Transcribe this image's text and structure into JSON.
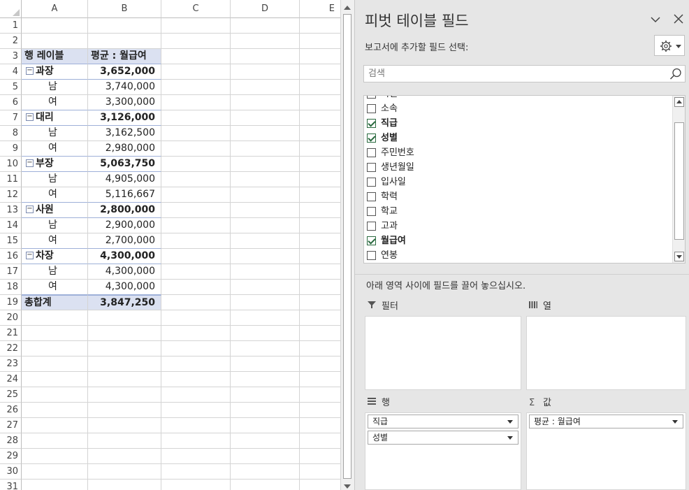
{
  "sheet": {
    "columns": [
      "A",
      "B",
      "C",
      "D",
      "E"
    ],
    "rows": [
      {
        "n": "1",
        "a": "",
        "b": "",
        "kind": "blank"
      },
      {
        "n": "2",
        "a": "",
        "b": "",
        "kind": "blank"
      },
      {
        "n": "3",
        "a": "행 레이블",
        "b": "평균 : 월급여",
        "kind": "header"
      },
      {
        "n": "4",
        "a": "과장",
        "b": "3,652,000",
        "kind": "group"
      },
      {
        "n": "5",
        "a": "남",
        "b": "3,740,000",
        "kind": "item"
      },
      {
        "n": "6",
        "a": "여",
        "b": "3,300,000",
        "kind": "item-last"
      },
      {
        "n": "7",
        "a": "대리",
        "b": "3,126,000",
        "kind": "group"
      },
      {
        "n": "8",
        "a": "남",
        "b": "3,162,500",
        "kind": "item"
      },
      {
        "n": "9",
        "a": "여",
        "b": "2,980,000",
        "kind": "item-last"
      },
      {
        "n": "10",
        "a": "부장",
        "b": "5,063,750",
        "kind": "group"
      },
      {
        "n": "11",
        "a": "남",
        "b": "4,905,000",
        "kind": "item"
      },
      {
        "n": "12",
        "a": "여",
        "b": "5,116,667",
        "kind": "item-last"
      },
      {
        "n": "13",
        "a": "사원",
        "b": "2,800,000",
        "kind": "group"
      },
      {
        "n": "14",
        "a": "남",
        "b": "2,900,000",
        "kind": "item"
      },
      {
        "n": "15",
        "a": "여",
        "b": "2,700,000",
        "kind": "item-last"
      },
      {
        "n": "16",
        "a": "차장",
        "b": "4,300,000",
        "kind": "group"
      },
      {
        "n": "17",
        "a": "남",
        "b": "4,300,000",
        "kind": "item"
      },
      {
        "n": "18",
        "a": "여",
        "b": "4,300,000",
        "kind": "item-last"
      },
      {
        "n": "19",
        "a": "총합계",
        "b": "3,847,250",
        "kind": "total"
      },
      {
        "n": "20",
        "a": "",
        "b": "",
        "kind": "blank"
      },
      {
        "n": "21",
        "a": "",
        "b": "",
        "kind": "blank"
      },
      {
        "n": "22",
        "a": "",
        "b": "",
        "kind": "blank"
      },
      {
        "n": "23",
        "a": "",
        "b": "",
        "kind": "blank"
      },
      {
        "n": "24",
        "a": "",
        "b": "",
        "kind": "blank"
      },
      {
        "n": "25",
        "a": "",
        "b": "",
        "kind": "blank"
      },
      {
        "n": "26",
        "a": "",
        "b": "",
        "kind": "blank"
      },
      {
        "n": "27",
        "a": "",
        "b": "",
        "kind": "blank"
      },
      {
        "n": "28",
        "a": "",
        "b": "",
        "kind": "blank"
      },
      {
        "n": "29",
        "a": "",
        "b": "",
        "kind": "blank"
      },
      {
        "n": "30",
        "a": "",
        "b": "",
        "kind": "blank"
      },
      {
        "n": "31",
        "a": "",
        "b": "",
        "kind": "blank"
      }
    ]
  },
  "pane": {
    "title": "피벗 테이블 필드",
    "select_label": "보고서에 추가할 필드 선택:",
    "search_placeholder": "검색",
    "fields": [
      {
        "label": "직렬",
        "checked": false
      },
      {
        "label": "소속",
        "checked": false
      },
      {
        "label": "직급",
        "checked": true
      },
      {
        "label": "성별",
        "checked": true
      },
      {
        "label": "주민번호",
        "checked": false
      },
      {
        "label": "생년월일",
        "checked": false
      },
      {
        "label": "입사일",
        "checked": false
      },
      {
        "label": "학력",
        "checked": false
      },
      {
        "label": "학교",
        "checked": false
      },
      {
        "label": "고과",
        "checked": false
      },
      {
        "label": "월급여",
        "checked": true
      },
      {
        "label": "연봉",
        "checked": false
      }
    ],
    "drag_hint": "아래 영역 사이에 필드를 끌어 놓으십시오.",
    "areas": {
      "filter": {
        "label": "필터",
        "icon": "filter-icon",
        "chips": []
      },
      "columns": {
        "label": "열",
        "icon": "columns-icon",
        "chips": []
      },
      "rows": {
        "label": "행",
        "icon": "rows-icon",
        "chips": [
          "직급",
          "성별"
        ]
      },
      "values": {
        "label": "값",
        "icon": "sigma-icon",
        "chips": [
          "평균 : 월급여"
        ]
      }
    }
  },
  "colors": {
    "pivot_header_fill": "#dbe1f1",
    "pane_background": "#e6e6e6",
    "checkbox_check": "#2a6a3f"
  }
}
